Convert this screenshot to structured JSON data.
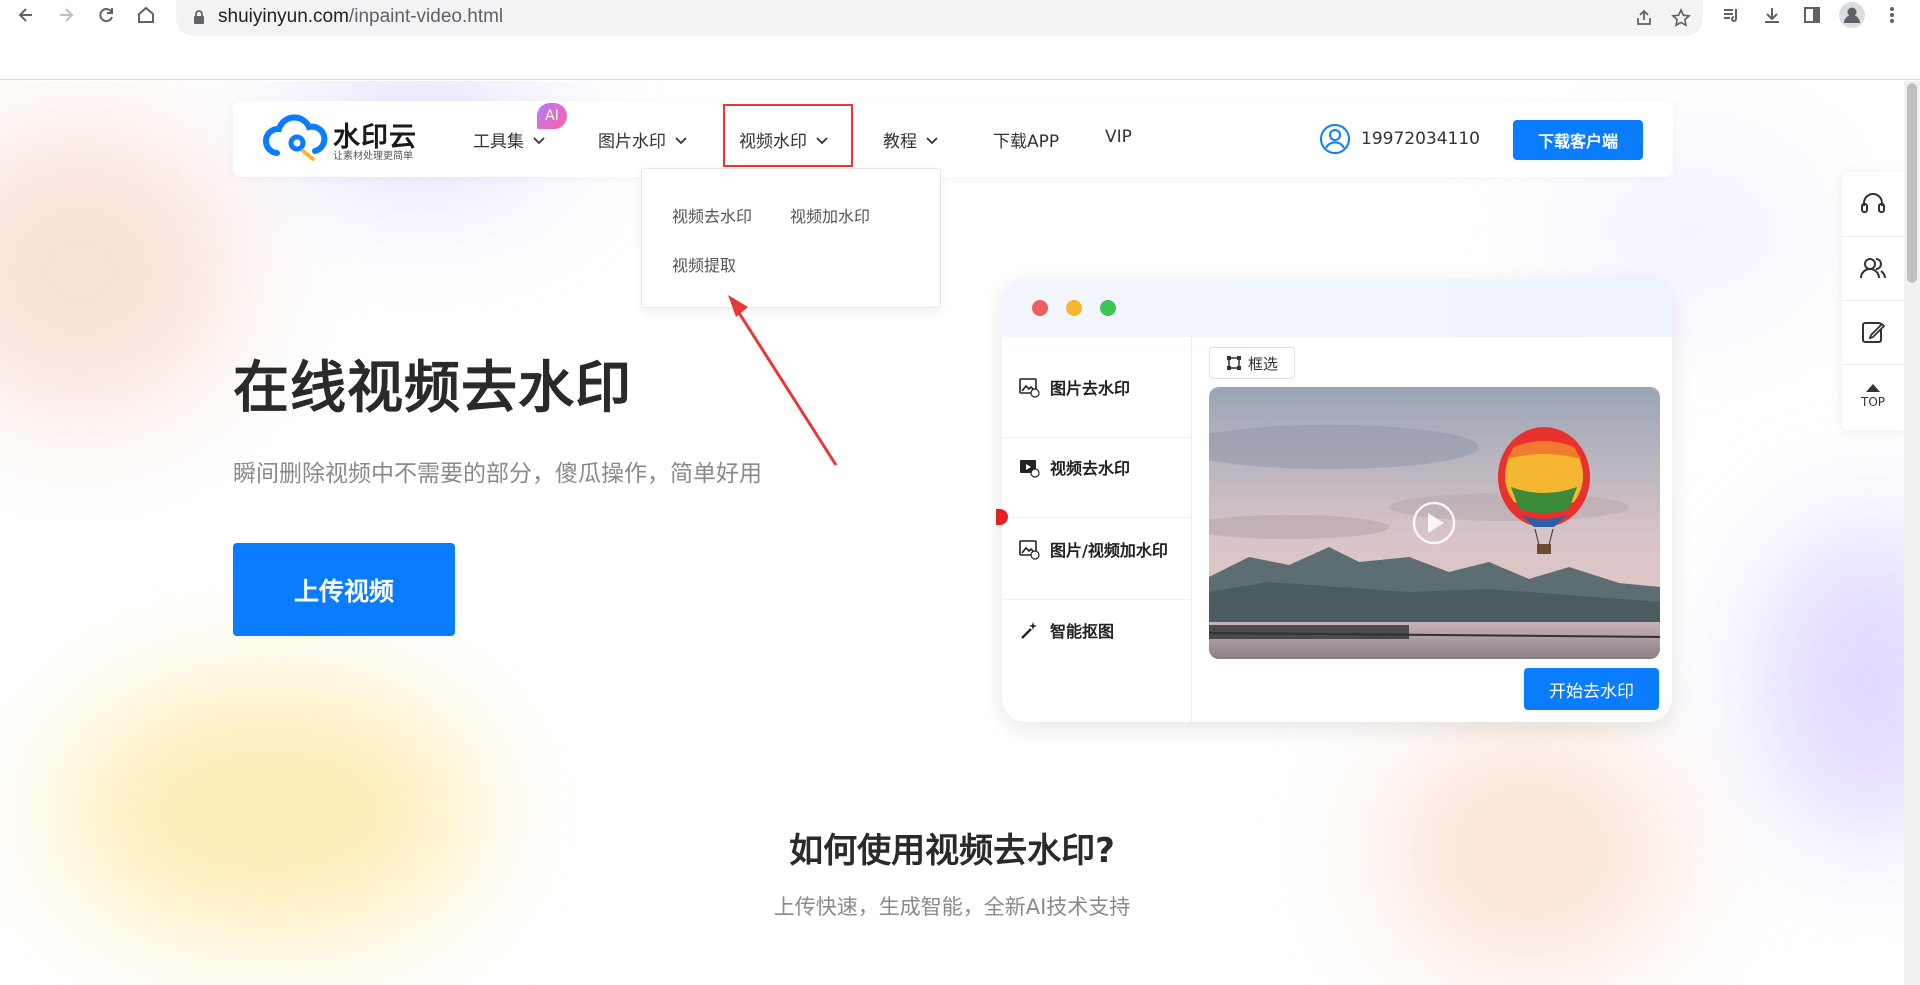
{
  "browser": {
    "url_host": "shuiyinyun.com",
    "url_path": "/inpaint-video.html"
  },
  "nav": {
    "logo_name": "水印云",
    "logo_slogan": "让素材处理更简单",
    "items": [
      {
        "label": "工具集"
      },
      {
        "label": "图片水印"
      },
      {
        "label": "视频水印"
      },
      {
        "label": "教程"
      },
      {
        "label": "下载APP"
      },
      {
        "label": "VIP"
      }
    ],
    "ai_badge": "AI",
    "phone": "19972034110",
    "download_label": "下载客户端"
  },
  "dropdown": {
    "items": [
      "视频去水印",
      "视频加水印",
      "视频提取"
    ]
  },
  "hero": {
    "title": "在线视频去水印",
    "subtitle": "瞬间删除视频中不需要的部分，傻瓜操作，简单好用",
    "upload_label": "上传视频"
  },
  "mock": {
    "sidebar": [
      {
        "label": "图片去水印",
        "icon": "image-icon"
      },
      {
        "label": "视频去水印",
        "icon": "video-icon"
      },
      {
        "label": "图片/视频加水印",
        "icon": "image-add-icon"
      },
      {
        "label": "智能抠图",
        "icon": "magic-wand-icon"
      }
    ],
    "frame_label": "框选",
    "start_label": "开始去水印",
    "window_dots": [
      "#ed5e5e",
      "#f5b731",
      "#3fc351"
    ]
  },
  "float_bar": {
    "top_label": "TOP"
  },
  "section": {
    "title": "如何使用视频去水印?",
    "subtitle": "上传快速，生成智能，全新AI技术支持"
  },
  "colors": {
    "accent": "#0a7cff",
    "highlight": "#e53935"
  }
}
